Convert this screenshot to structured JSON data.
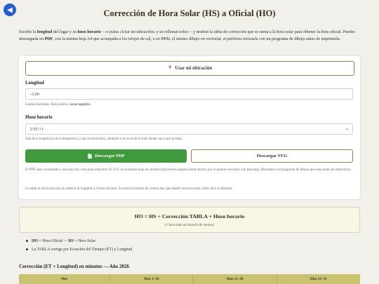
{
  "back_icon": "arrow-left-icon",
  "title": "Corrección de Hora Solar (HS) a Oficial (HO)",
  "intro": {
    "p1": "Escribe la ",
    "b1": "longitud",
    "p2": " del lugar y su ",
    "b2": "huso horario",
    "p3": " —o pulsa «Usar mi ubicación» y se rellenan solos— y tendrás la tabla de corrección que se suma a la hora solar para obtener la hora oficial. Puedes descargarla en ",
    "b3": "PDF",
    "p4": ", con la misma hoja A4 que acompaña a los relojes de sol, o en ",
    "b4": "SVG",
    "p5": ", el mismo dibujo en vectorial, si prefieres retocarla con un programa de dibujo antes de imprimirla."
  },
  "location_button": {
    "icon": "pin-icon",
    "label": "Usar mi ubicación"
  },
  "longitude": {
    "label": "Longitud",
    "value": "-3,00",
    "hint_prefix": "Grados decimales. Este positivo, ",
    "hint_bold": "oeste negativo",
    "hint_suffix": "."
  },
  "timezone": {
    "label": "Huso horario",
    "value": "UTC+1",
    "hint": "Sale de la longitud (o de tu dispositivo, si das la ubicación); cámbialo si no es el de la zona donde vas a usar la tabla."
  },
  "pdf_button": {
    "icon": "document-icon",
    "label": "Descargar PDF"
  },
  "svg_button": {
    "label": "Descargar SVG"
  },
  "note1": "El PDF sale ya ajustado a una hoja A4, listo para imprimir. El SVG es la misma hoja en vectorial (los textos siguen siendo texto), por si quieres retocarla con Inkscape, Illustrator o el programa de dibujo que uses antes de imprimirla.",
  "note2": "La tabla se recalcula sola al cambiar la longitud o el huso horario. Si estás en horario de verano hay que añadir una hora más, como dice la fórmula.",
  "formula": {
    "main": "HO = HS + Corrección TABLA + Huso horario",
    "sub": "(1 hora más en horario de verano)"
  },
  "legend": {
    "ho_bold": "HO",
    "ho_text": " = Hora Oficial",
    "sep": "•",
    "hs_bold": "HS",
    "hs_text": " = Hora Solar",
    "line2": "La TABLA corrige por Ecuación del Tiempo (ET) y Longitud"
  },
  "table_title": "Corrección (ET + Longitud) en minutos — Año 2026",
  "table_headers": [
    "Mes",
    "Días 1–10",
    "Días 11–20",
    "Días 21–31"
  ],
  "colors": {
    "accent": "#1f5fd1",
    "pdf_green": "#3f9a3c",
    "table_header": "#c9c26e",
    "formula_bg": "#f8f6e4"
  }
}
